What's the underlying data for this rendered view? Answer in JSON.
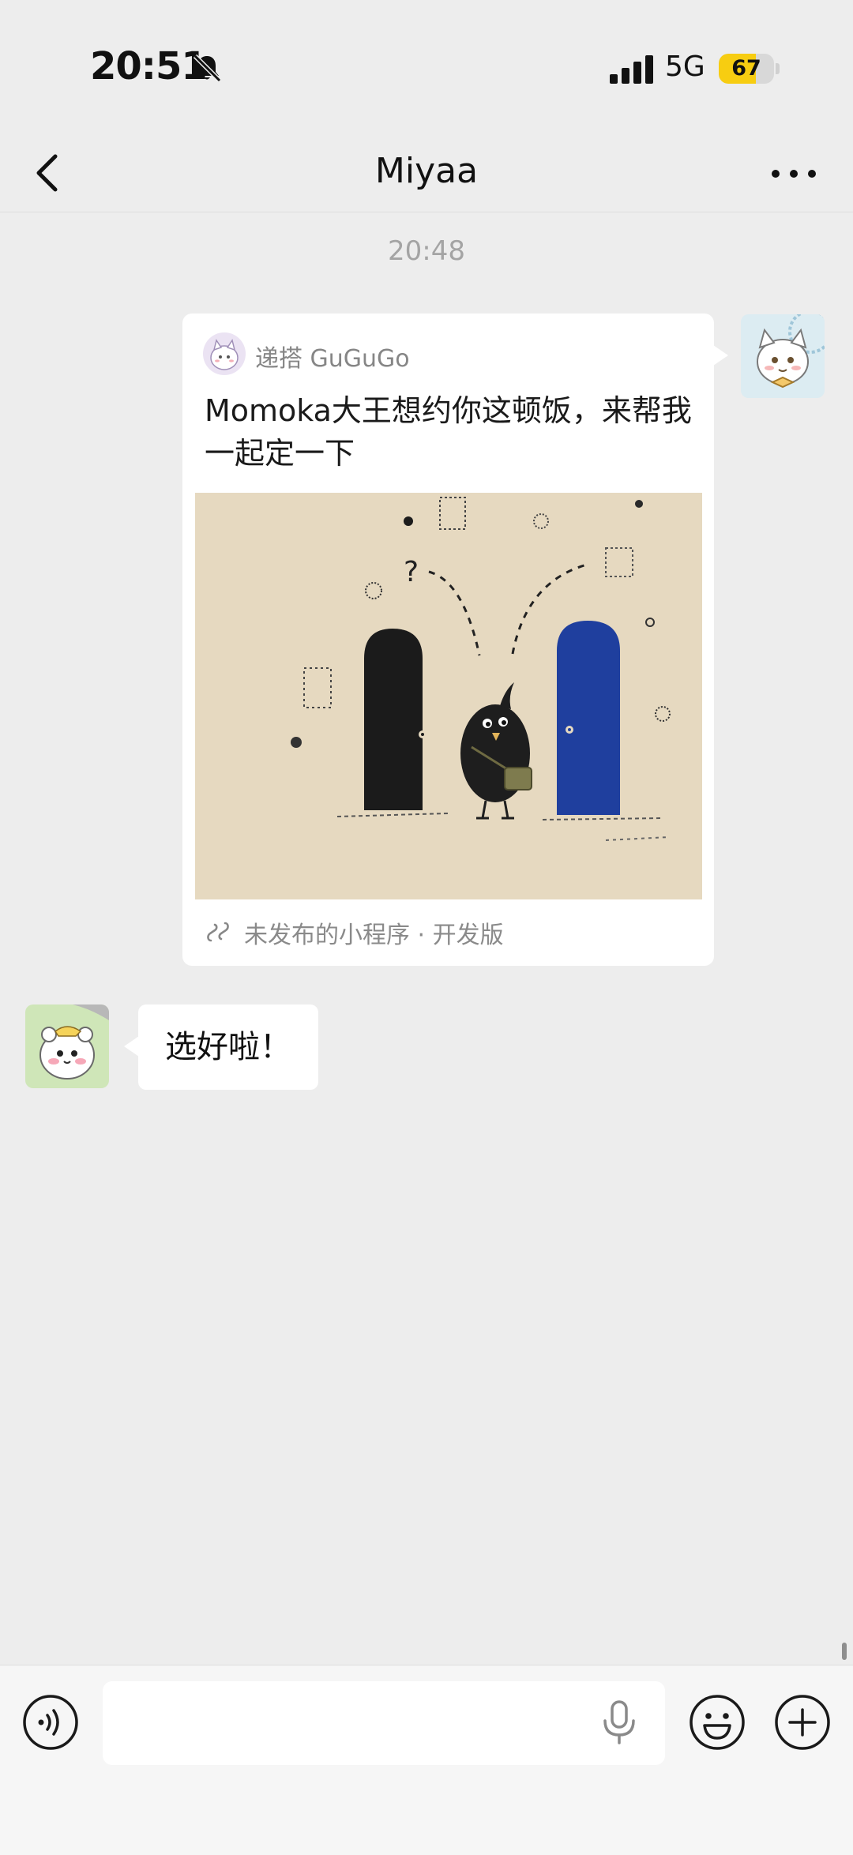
{
  "status_bar": {
    "time": "20:51",
    "network": "5G",
    "battery_level": "67",
    "battery_fill": 0.67,
    "battery_color": "#f7cd11"
  },
  "nav": {
    "title": "Miyaa",
    "back_icon": "chevron-left-icon",
    "more_icon": "more-dots-icon"
  },
  "chat": {
    "timestamp": "20:48",
    "messages": [
      {
        "type": "mini_program_card",
        "sender": "self",
        "avatar_icon": "cat-avatar",
        "source_name": "递搭 GuGuGo",
        "title": "Momoka大王想约你这顿饭，来帮我一起定一下",
        "image_icon": "bird-between-two-doors-illustration",
        "footer": "未发布的小程序 · 开发版"
      },
      {
        "type": "text",
        "sender": "other",
        "avatar_icon": "hamster-avatar",
        "text": "选好啦！"
      }
    ]
  },
  "input_bar": {
    "voice_icon": "voice-icon",
    "mic_icon": "mic-icon",
    "emoji_icon": "emoji-icon",
    "plus_icon": "plus-icon"
  },
  "colors": {
    "background": "#ededed",
    "bubble": "#ffffff",
    "timestamp": "#a4a4a4",
    "card_footer": "#8a8a8a",
    "door_blue": "#1f3f9e"
  }
}
